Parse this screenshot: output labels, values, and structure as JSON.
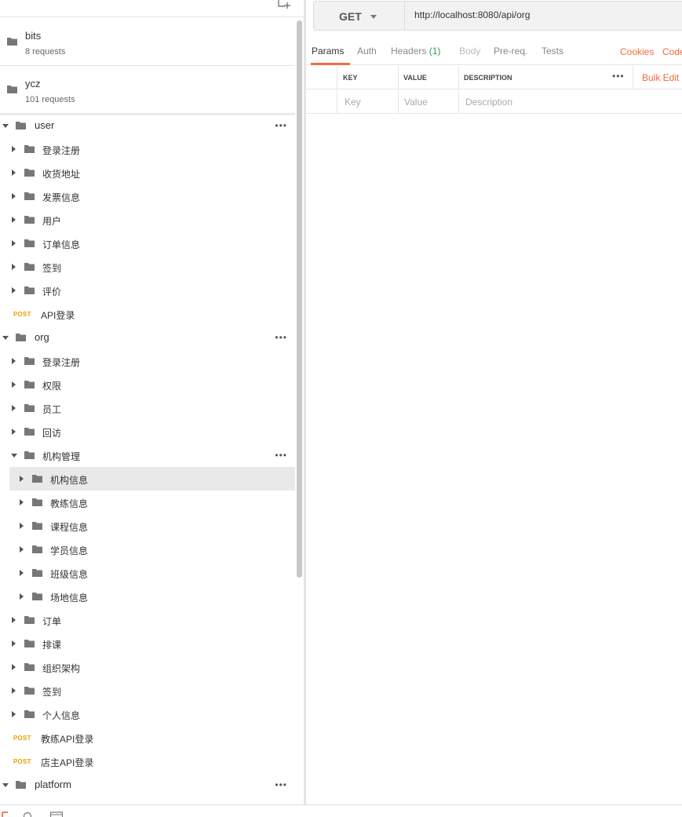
{
  "sidebar": {
    "collections": [
      {
        "name": "bits",
        "count": "8 requests"
      },
      {
        "name": "ycz",
        "count": "101 requests"
      }
    ],
    "tree": [
      {
        "label": "user",
        "type": "folder",
        "depth": 0,
        "expanded": true,
        "more": true
      },
      {
        "label": "登录注册",
        "type": "folder",
        "depth": 1
      },
      {
        "label": "收货地址",
        "type": "folder",
        "depth": 1
      },
      {
        "label": "发票信息",
        "type": "folder",
        "depth": 1
      },
      {
        "label": "用户",
        "type": "folder",
        "depth": 1
      },
      {
        "label": "订单信息",
        "type": "folder",
        "depth": 1
      },
      {
        "label": "签到",
        "type": "folder",
        "depth": 1
      },
      {
        "label": "评价",
        "type": "folder",
        "depth": 1
      },
      {
        "label": "API登录",
        "type": "request",
        "method": "POST"
      },
      {
        "label": "org",
        "type": "folder",
        "depth": 0,
        "expanded": true,
        "more": true
      },
      {
        "label": "登录注册",
        "type": "folder",
        "depth": 1
      },
      {
        "label": "权限",
        "type": "folder",
        "depth": 1
      },
      {
        "label": "员工",
        "type": "folder",
        "depth": 1
      },
      {
        "label": "回访",
        "type": "folder",
        "depth": 1
      },
      {
        "label": "机构管理",
        "type": "folder",
        "depth": 1,
        "expanded": true,
        "more": true
      },
      {
        "label": "机构信息",
        "type": "folder",
        "depth": 2,
        "selected": true
      },
      {
        "label": "教练信息",
        "type": "folder",
        "depth": 2
      },
      {
        "label": "课程信息",
        "type": "folder",
        "depth": 2
      },
      {
        "label": "学员信息",
        "type": "folder",
        "depth": 2
      },
      {
        "label": "班级信息",
        "type": "folder",
        "depth": 2
      },
      {
        "label": "场地信息",
        "type": "folder",
        "depth": 2
      },
      {
        "label": "订单",
        "type": "folder",
        "depth": 1
      },
      {
        "label": "排课",
        "type": "folder",
        "depth": 1
      },
      {
        "label": "组织架构",
        "type": "folder",
        "depth": 1
      },
      {
        "label": "签到",
        "type": "folder",
        "depth": 1
      },
      {
        "label": "个人信息",
        "type": "folder",
        "depth": 1
      },
      {
        "label": "教练API登录",
        "type": "request",
        "method": "POST"
      },
      {
        "label": "店主API登录",
        "type": "request",
        "method": "POST"
      },
      {
        "label": "platform",
        "type": "folder",
        "depth": 0,
        "expanded": true,
        "more": true
      }
    ]
  },
  "request": {
    "method": "GET",
    "url": "http://localhost:8080/api/org",
    "tabs": [
      {
        "label": "Params",
        "state": "active"
      },
      {
        "label": "Auth",
        "state": "normal"
      },
      {
        "label": "Headers",
        "count": "(1)",
        "state": "normal"
      },
      {
        "label": "Body",
        "state": "disabled"
      },
      {
        "label": "Pre-req.",
        "state": "normal"
      },
      {
        "label": "Tests",
        "state": "normal"
      }
    ],
    "cookies_link": "Cookies",
    "code_link": "Code"
  },
  "params": {
    "columns": {
      "key": "KEY",
      "value": "VALUE",
      "description": "DESCRIPTION"
    },
    "more": "•••",
    "bulk_edit": "Bulk Edit",
    "placeholders": {
      "key": "Key",
      "value": "Value",
      "description": "Description"
    }
  },
  "colors": {
    "accent": "#f26b3a",
    "post_method": "#e8a200",
    "headers_count": "#2a9d5c",
    "selected_row": "#e9e9e9"
  },
  "icons": {
    "new_collection": "new-collection-icon",
    "folder": "folder-icon",
    "more": "more-options-icon"
  }
}
